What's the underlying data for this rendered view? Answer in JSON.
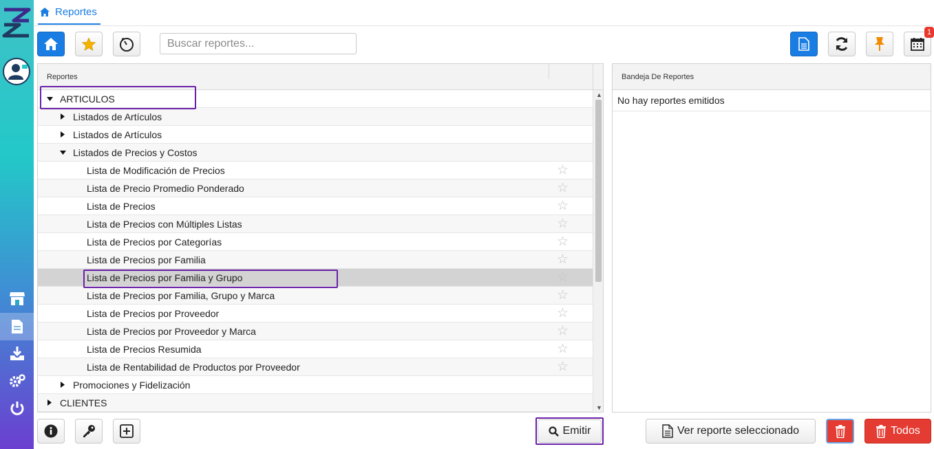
{
  "nav": {
    "tab_label": "Reportes",
    "icons": [
      "logo",
      "user-avatar-icon",
      "store-icon",
      "document-icon",
      "download-tray-icon",
      "gears-icon",
      "power-icon"
    ]
  },
  "toolbar": {
    "search_placeholder": "Buscar reportes...",
    "calendar_badge": "1"
  },
  "reports_panel": {
    "header": "Reportes",
    "rows": [
      {
        "label": "ARTICULOS",
        "level": 0,
        "expanded": true
      },
      {
        "label": "Listados de Artículos",
        "level": 1,
        "expanded": false
      },
      {
        "label": "Listados de Artículos",
        "level": 1,
        "expanded": false
      },
      {
        "label": "Listados de Precios y Costos",
        "level": 1,
        "expanded": true
      },
      {
        "label": "Lista de Modificación de Precios",
        "level": 2,
        "star": true
      },
      {
        "label": "Lista de Precio Promedio Ponderado",
        "level": 2,
        "star": true
      },
      {
        "label": "Lista de Precios",
        "level": 2,
        "star": true
      },
      {
        "label": "Lista de Precios con Múltiples Listas",
        "level": 2,
        "star": true
      },
      {
        "label": "Lista de Precios por Categorías",
        "level": 2,
        "star": true
      },
      {
        "label": "Lista de Precios por Familia",
        "level": 2,
        "star": true
      },
      {
        "label": "Lista de Precios por Familia y Grupo",
        "level": 2,
        "star": true,
        "selected": true
      },
      {
        "label": "Lista de Precios por Familia, Grupo y Marca",
        "level": 2,
        "star": true
      },
      {
        "label": "Lista de Precios por Proveedor",
        "level": 2,
        "star": true
      },
      {
        "label": "Lista de Precios por Proveedor y Marca",
        "level": 2,
        "star": true
      },
      {
        "label": "Lista de Precios Resumida",
        "level": 2,
        "star": true
      },
      {
        "label": "Lista de Rentabilidad de Productos por Proveedor",
        "level": 2,
        "star": true
      },
      {
        "label": "Promociones y Fidelización",
        "level": 1,
        "expanded": false
      },
      {
        "label": "CLIENTES",
        "level": 0,
        "expanded": false
      }
    ]
  },
  "tray_panel": {
    "header": "Bandeja De Reportes",
    "empty_message": "No hay reportes emitidos"
  },
  "footer": {
    "emit_label": "Emitir",
    "view_label": "Ver reporte seleccionado",
    "all_label": "Todos"
  },
  "colors": {
    "accent": "#1a7de3",
    "danger": "#e43b32",
    "highlight": "#6a1fa8"
  }
}
